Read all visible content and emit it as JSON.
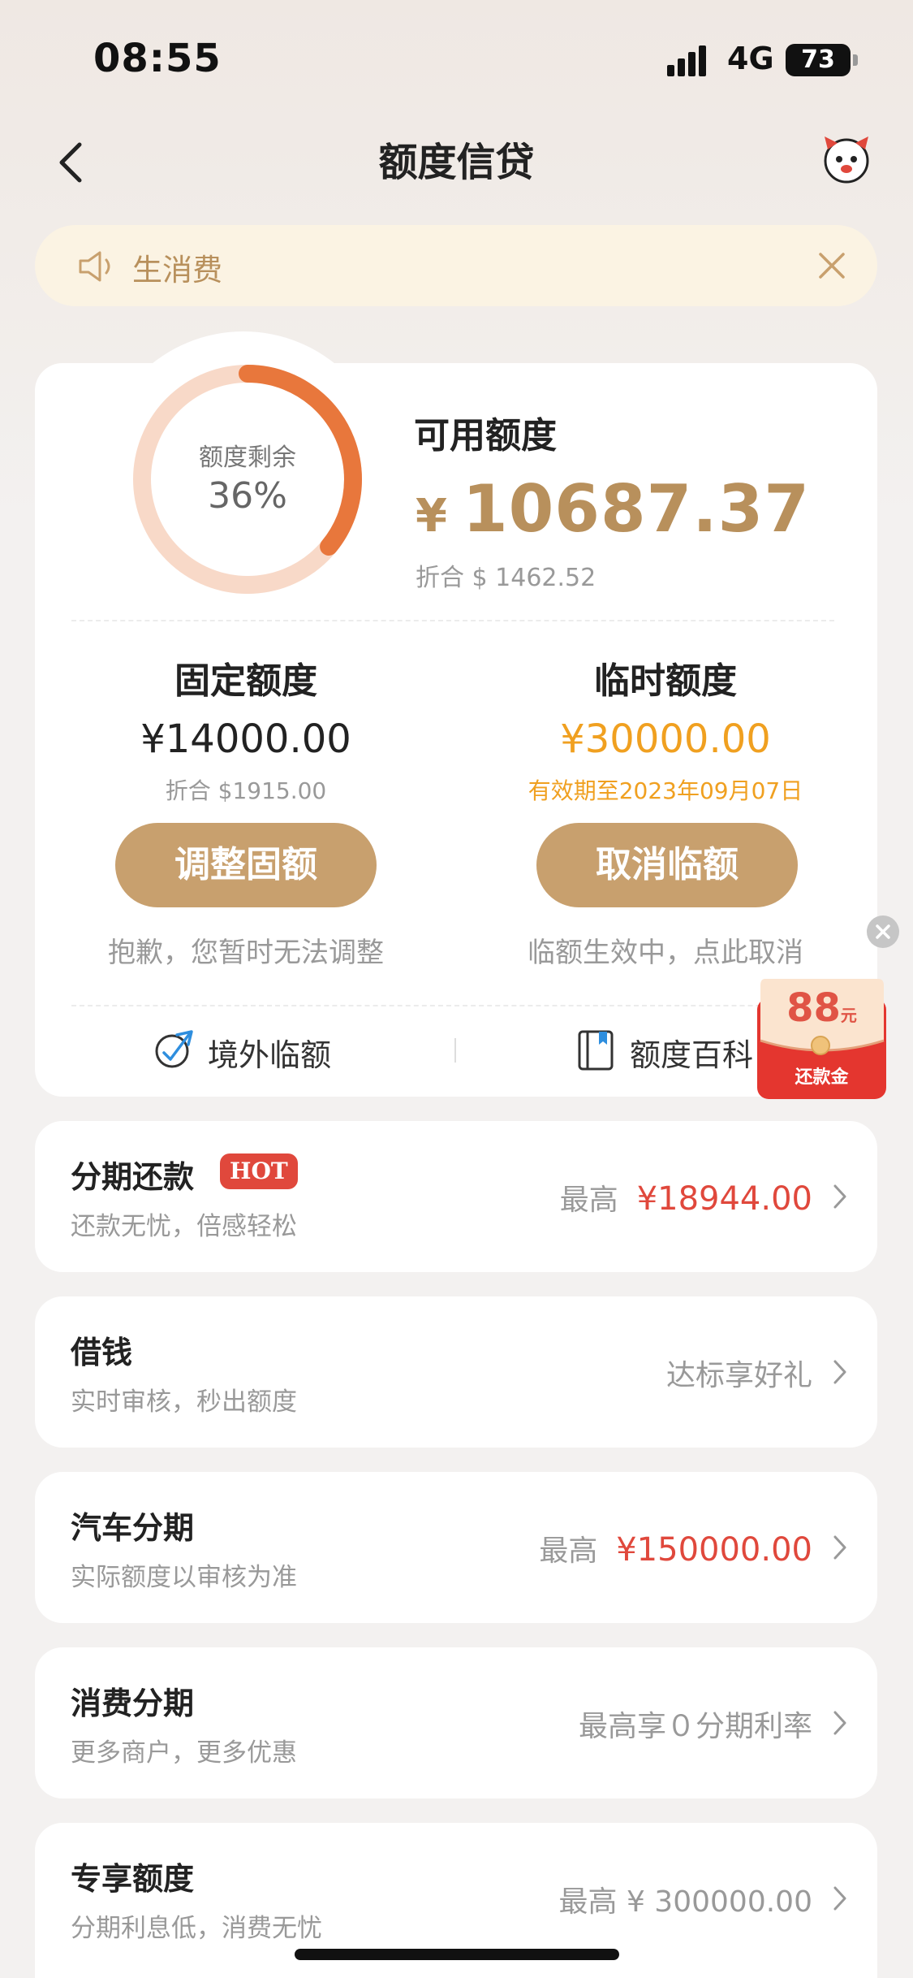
{
  "status_bar": {
    "time": "08:55",
    "network": "4G",
    "battery": "73"
  },
  "nav": {
    "title": "额度信贷"
  },
  "notice": {
    "text": "生消费"
  },
  "credit": {
    "ring_label": "额度剩余",
    "remaining_percent": "36%",
    "remaining_fraction": 0.36,
    "available_label": "可用额度",
    "available_currency": "¥",
    "available_amount": "10687.37",
    "available_converted": "折合 $ 1462.52",
    "fixed": {
      "title": "固定额度",
      "amount": "¥14000.00",
      "converted": "折合 $1915.00",
      "button": "调整固额",
      "note": "抱歉，您暂时无法调整"
    },
    "temporary": {
      "title": "临时额度",
      "amount": "¥30000.00",
      "validity": "有效期至2023年09月07日",
      "button": "取消临额",
      "note": "临额生效中，点此取消"
    },
    "links": {
      "overseas": "境外临额",
      "encyclopedia": "额度百科"
    }
  },
  "floating_promo": {
    "amount": "88",
    "unit": "元",
    "label": "还款金"
  },
  "list": [
    {
      "title": "分期还款",
      "badge": "HOT",
      "subtitle": "还款无忧，倍感轻松",
      "right_prefix": "最高",
      "right_value": "¥18944.00"
    },
    {
      "title": "借钱",
      "subtitle": "实时审核，秒出额度",
      "right_text": "达标享好礼"
    },
    {
      "title": "汽车分期",
      "subtitle": "实际额度以审核为准",
      "right_prefix": "最高",
      "right_value": "¥150000.00"
    },
    {
      "title": "消费分期",
      "subtitle": "更多商户，更多优惠",
      "right_text": "最高享０分期利率"
    },
    {
      "title": "专享额度",
      "subtitle": "分期利息低，消费无忧",
      "right_text": "最高 ¥ 300000.00"
    }
  ],
  "colors": {
    "accent_gold": "#c8a06e",
    "amount_gold": "#b8905c",
    "orange": "#f0a020",
    "red": "#e0483c",
    "ring_orange": "#e8773c",
    "ring_track": "#f8d9c8"
  }
}
